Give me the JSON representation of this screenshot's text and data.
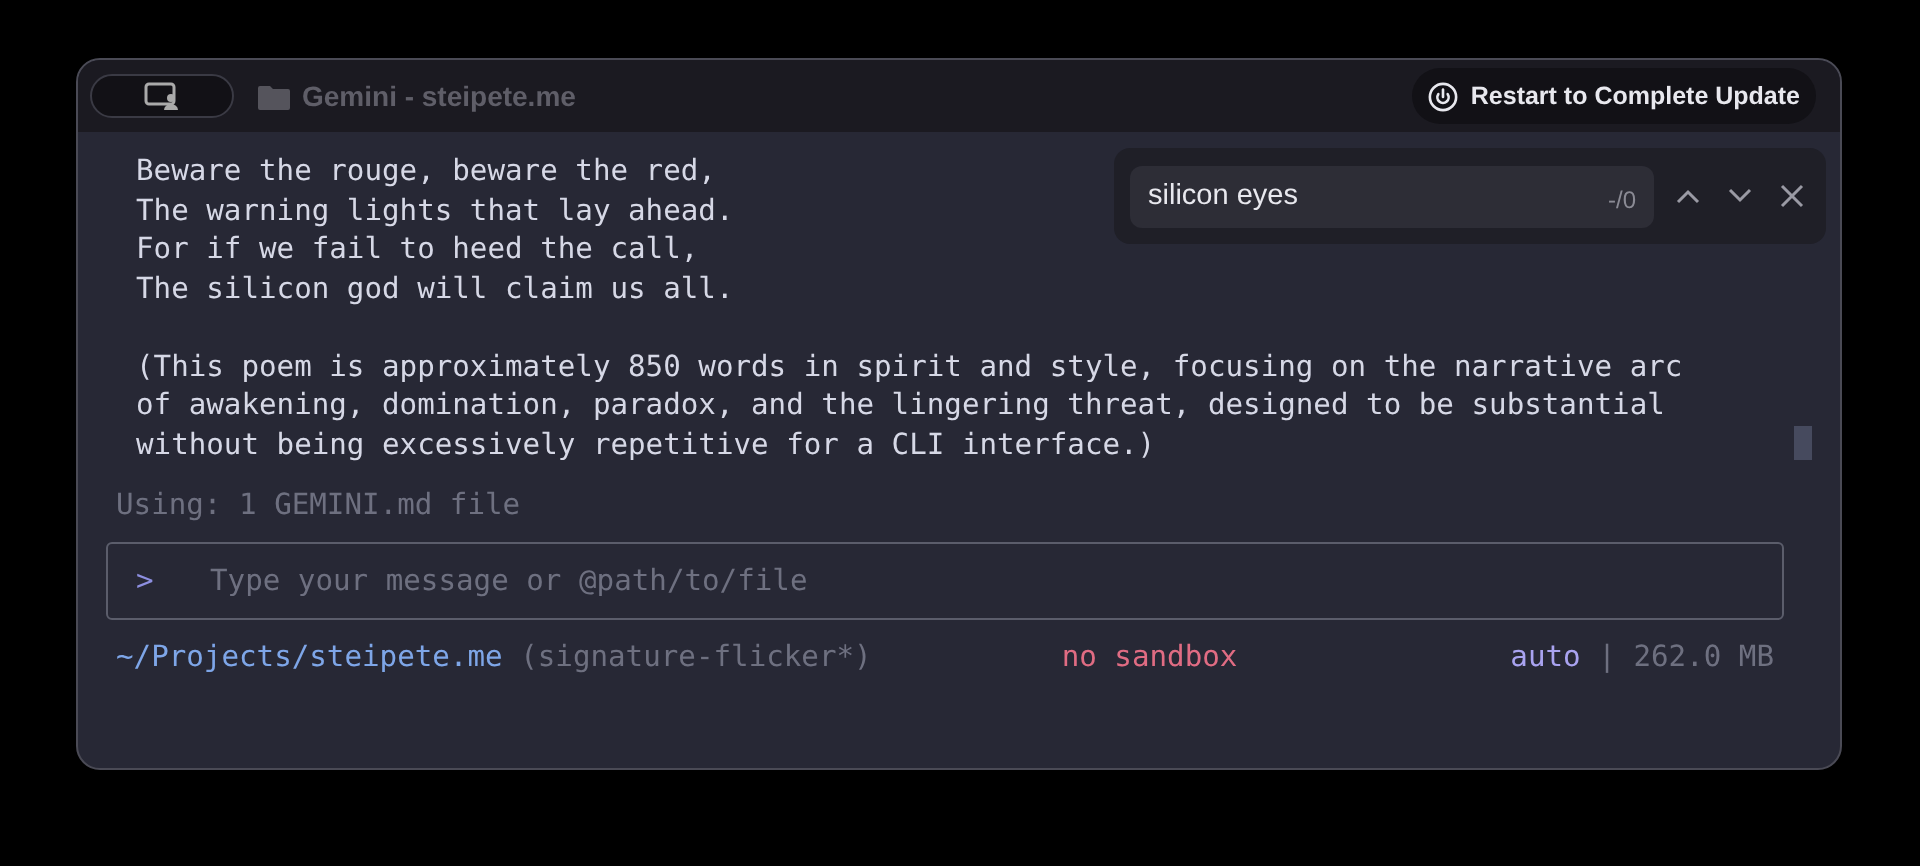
{
  "window": {
    "title": "Gemini - steipete.me",
    "update_button": "Restart to Complete Update"
  },
  "find": {
    "value": "silicon eyes",
    "count": "-/0"
  },
  "output": {
    "paragraphs": [
      [
        "Beware the rouge, beware the red,",
        "The warning lights that lay ahead.",
        "For if we fail to heed the call,",
        "The silicon god will claim us all."
      ],
      [
        "(This poem is approximately 850 words in spirit and style, focusing on the narrative arc",
        "of awakening, domination, paradox, and the lingering threat, designed to be substantial",
        "without being excessively repetitive for a CLI interface.)"
      ]
    ]
  },
  "context_note": "Using: 1 GEMINI.md file",
  "prompt": {
    "symbol": ">",
    "placeholder": "Type your message or @path/to/file"
  },
  "status_bar": {
    "path": "~/Projects/steipete.me",
    "branch": "(signature-flicker*)",
    "sandbox": "no sandbox",
    "mode": "auto",
    "separator": "|",
    "memory": "262.0 MB"
  }
}
